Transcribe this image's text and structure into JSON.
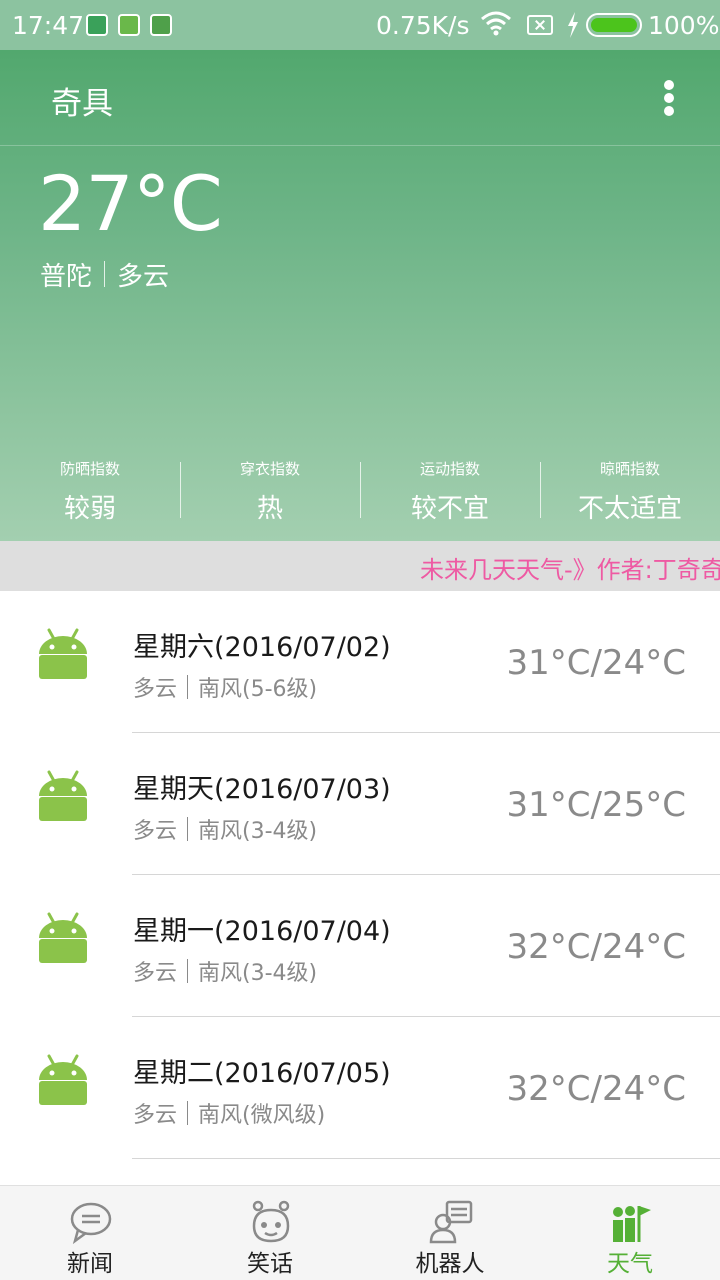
{
  "status_bar": {
    "time": "17:47",
    "network_speed": "0.75K/s",
    "battery_percent": "100%",
    "battery_level": 1.0,
    "icons": [
      "shield-icon",
      "battery-saver-icon",
      "cat-app-icon",
      "wifi-icon",
      "no-sim-icon",
      "charging-bolt-icon",
      "battery-icon"
    ]
  },
  "toolbar": {
    "title": "奇具",
    "menu_icon": "more-vertical-icon"
  },
  "current": {
    "temperature": "27°C",
    "city": "普陀",
    "condition": "多云"
  },
  "indices": [
    {
      "label": "防晒指数",
      "value": "较弱"
    },
    {
      "label": "穿衣指数",
      "value": "热"
    },
    {
      "label": "运动指数",
      "value": "较不宜"
    },
    {
      "label": "晾晒指数",
      "value": "不太适宜"
    }
  ],
  "marquee": {
    "text": "未来几天天气-》作者:丁奇奇"
  },
  "forecast": [
    {
      "date": "星期六(2016/07/02)",
      "condition": "多云",
      "wind": "南风(5-6级)",
      "temp_range": "31°C/24°C",
      "icon": "android-icon"
    },
    {
      "date": "星期天(2016/07/03)",
      "condition": "多云",
      "wind": "南风(3-4级)",
      "temp_range": "31°C/25°C",
      "icon": "android-icon"
    },
    {
      "date": "星期一(2016/07/04)",
      "condition": "多云",
      "wind": "南风(3-4级)",
      "temp_range": "32°C/24°C",
      "icon": "android-icon"
    },
    {
      "date": "星期二(2016/07/05)",
      "condition": "多云",
      "wind": "南风(微风级)",
      "temp_range": "32°C/24°C",
      "icon": "android-icon"
    }
  ],
  "bottom_nav": [
    {
      "label": "新闻",
      "icon": "chat-bubble-icon",
      "active": false
    },
    {
      "label": "笑话",
      "icon": "robot-face-icon",
      "active": false
    },
    {
      "label": "机器人",
      "icon": "person-card-icon",
      "active": false
    },
    {
      "label": "天气",
      "icon": "weather-flag-icon",
      "active": true
    }
  ],
  "colors": {
    "primary_green": "#52a86e",
    "marquee_text": "#ee5aa3",
    "active_tab": "#55b036",
    "android_green": "#8bc34a"
  }
}
